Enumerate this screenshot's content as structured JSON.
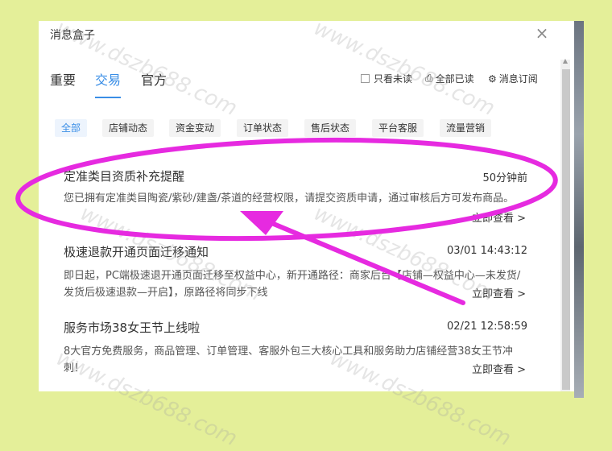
{
  "panel": {
    "title": "消息盒子",
    "close_glyph": "×"
  },
  "tabs": [
    {
      "label": "重要",
      "active": false
    },
    {
      "label": "交易",
      "active": true
    },
    {
      "label": "官方",
      "active": false
    }
  ],
  "tools": {
    "unread_only": "只看未读",
    "mark_all_read": "全部已读",
    "subscribe": "消息订阅"
  },
  "filters": [
    {
      "label": "全部",
      "active": true
    },
    {
      "label": "店铺动态",
      "active": false
    },
    {
      "label": "资金变动",
      "active": false
    },
    {
      "label": "订单状态",
      "active": false
    },
    {
      "label": "售后状态",
      "active": false
    },
    {
      "label": "平台客服",
      "active": false
    },
    {
      "label": "流量营销",
      "active": false
    }
  ],
  "messages": [
    {
      "title": "定准类目资质补充提醒",
      "time": "50分钟前",
      "body": "您已拥有定准类目陶瓷/紫砂/建盏/茶道的经营权限，请提交资质申请，通过审核后方可发布商品。",
      "link": "立即查看 >"
    },
    {
      "title": "极速退款开通页面迁移通知",
      "time": "03/01 14:43:12",
      "body": "即日起，PC端极速退开通页面迁移至权益中心，新开通路径：商家后台【店铺—权益中心—未发货/发货后极速退款—开启】，原路径将同步下线",
      "link": "立即查看 >"
    },
    {
      "title": "服务市场38女王节上线啦",
      "time": "02/21 12:58:59",
      "body": "8大官方免费服务，商品管理、订单管理、客服外包三大核心工具和服务助力店铺经营38女王节冲刺！",
      "link": "立即查看 >"
    }
  ],
  "watermark": "www.dszb688.com",
  "colors": {
    "accent": "#3a8ee6",
    "highlight": "#e62ae0",
    "background": "#e4ef99"
  }
}
